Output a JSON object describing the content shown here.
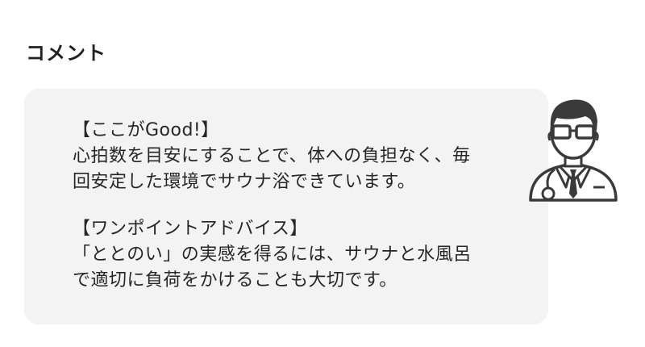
{
  "section": {
    "heading": "コメント"
  },
  "comment": {
    "good_title": "【ここがGood!】",
    "good_lines": [
      "心拍数を目安にすることで、体への負担なく、毎",
      "回安定した環境でサウナ浴できています。"
    ],
    "advice_title": "【ワンポイントアドバイス】",
    "advice_lines": [
      "「ととのい」の実感を得るには、サウナと水風呂",
      "で適切に負荷をかけることも大切です。"
    ]
  },
  "avatar": {
    "icon": "doctor-avatar-icon"
  }
}
